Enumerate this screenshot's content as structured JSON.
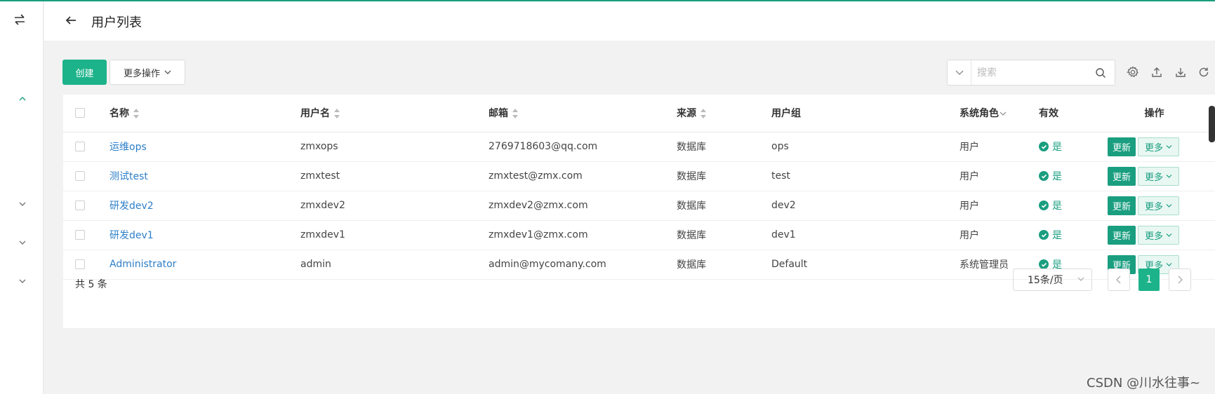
{
  "app": {
    "accent_color": "#1db38a",
    "link_color": "#2d7fc9"
  },
  "sidebar": {
    "toggle_icon": "swap-arrows-icon",
    "expand_icons": [
      "chevron-up-icon",
      "chevron-down-icon",
      "chevron-down-icon",
      "chevron-down-icon"
    ]
  },
  "header": {
    "title": "用户列表",
    "back_icon": "arrow-left-icon"
  },
  "toolbar": {
    "create_label": "创建",
    "more_actions_label": "更多操作",
    "search_placeholder": "搜索",
    "tools": [
      "settings-icon",
      "upload-icon",
      "download-icon",
      "refresh-icon"
    ]
  },
  "table": {
    "columns": [
      "名称",
      "用户名",
      "邮箱",
      "来源",
      "用户组",
      "系统角色",
      "有效",
      "操作"
    ],
    "rows": [
      {
        "name": "运维ops",
        "username": "zmxops",
        "email": "2769718603@qq.com",
        "source": "数据库",
        "group": "ops",
        "role": "用户",
        "valid": "是"
      },
      {
        "name": "测试test",
        "username": "zmxtest",
        "email": "zmxtest@zmx.com",
        "source": "数据库",
        "group": "test",
        "role": "用户",
        "valid": "是"
      },
      {
        "name": "研发dev2",
        "username": "zmxdev2",
        "email": "zmxdev2@zmx.com",
        "source": "数据库",
        "group": "dev2",
        "role": "用户",
        "valid": "是"
      },
      {
        "name": "研发dev1",
        "username": "zmxdev1",
        "email": "zmxdev1@zmx.com",
        "source": "数据库",
        "group": "dev1",
        "role": "用户",
        "valid": "是"
      },
      {
        "name": "Administrator",
        "username": "admin",
        "email": "admin@mycomany.com",
        "source": "数据库",
        "group": "Default",
        "role": "系统管理员",
        "valid": "是"
      }
    ],
    "row_update_label": "更新",
    "row_more_label": "更多"
  },
  "pagination": {
    "total": "共 5 条",
    "page_size": "15条/页",
    "current_page": "1"
  },
  "watermark": "CSDN @川水往事~"
}
